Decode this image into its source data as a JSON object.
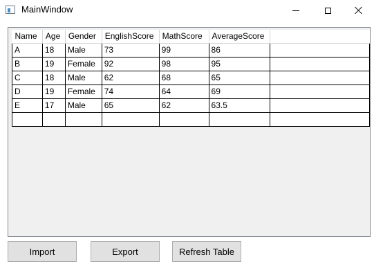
{
  "window": {
    "title": "MainWindow"
  },
  "table": {
    "columns": [
      "Name",
      "Age",
      "Gender",
      "EnglishScore",
      "MathScore",
      "AverageScore"
    ],
    "rows": [
      [
        "A",
        "18",
        "Male",
        "73",
        "99",
        "86"
      ],
      [
        "B",
        "19",
        "Female",
        "92",
        "98",
        "95"
      ],
      [
        "C",
        "18",
        "Male",
        "62",
        "68",
        "65"
      ],
      [
        "D",
        "19",
        "Female",
        "74",
        "64",
        "69"
      ],
      [
        "E",
        "17",
        "Male",
        "65",
        "62",
        "63.5"
      ],
      [
        "",
        "",
        "",
        "",
        "",
        ""
      ]
    ]
  },
  "buttons": {
    "import_label": "Import",
    "export_label": "Export",
    "refresh_label": "Refresh Table"
  }
}
